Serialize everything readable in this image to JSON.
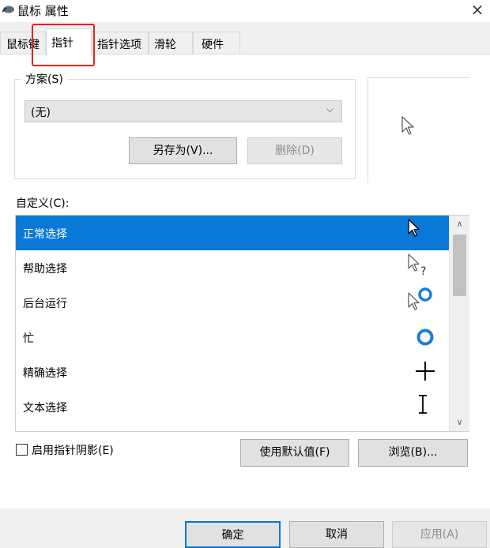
{
  "window": {
    "title": "鼠标 属性",
    "close_symbol": "×"
  },
  "tabs": [
    {
      "label": "鼠标键"
    },
    {
      "label": "指针"
    },
    {
      "label": "指针选项"
    },
    {
      "label": "滑轮"
    },
    {
      "label": "硬件"
    }
  ],
  "scheme": {
    "label": "方案(S)",
    "value": "(无)",
    "save_as": "另存为(V)...",
    "delete": "删除(D)"
  },
  "customize": {
    "label": "自定义(C):",
    "items": [
      {
        "label": "正常选择",
        "icon": "arrow-cursor-icon"
      },
      {
        "label": "帮助选择",
        "icon": "help-cursor-icon"
      },
      {
        "label": "后台运行",
        "icon": "working-in-background-cursor-icon"
      },
      {
        "label": "忙",
        "icon": "busy-cursor-icon"
      },
      {
        "label": "精确选择",
        "icon": "crosshair-cursor-icon"
      },
      {
        "label": "文本选择",
        "icon": "text-cursor-icon"
      }
    ]
  },
  "options": {
    "shadow_label": "启用指针阴影(E)",
    "defaults": "使用默认值(F)",
    "browse": "浏览(B)..."
  },
  "dialog": {
    "ok": "确定",
    "cancel": "取消",
    "apply": "应用(A)"
  },
  "colors": {
    "selection": "#0a78d7",
    "accent": "#0078d7",
    "highlight": "#e3241f"
  }
}
